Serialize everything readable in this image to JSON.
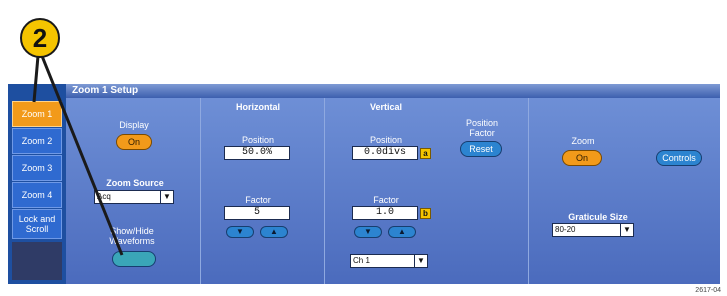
{
  "callout": {
    "number": "2"
  },
  "tabs": [
    {
      "label": "Zoom 1",
      "active": true
    },
    {
      "label": "Zoom 2",
      "active": false
    },
    {
      "label": "Zoom 3",
      "active": false
    },
    {
      "label": "Zoom 4",
      "active": false
    },
    {
      "label": "Lock and Scroll",
      "active": false
    }
  ],
  "panel": {
    "title": "Zoom 1 Setup",
    "display": {
      "label": "Display",
      "button": "On"
    },
    "zoom_source": {
      "label": "Zoom Source",
      "value": "Acq"
    },
    "show_hide": {
      "label": "Show/Hide Waveforms"
    },
    "horizontal": {
      "heading": "Horizontal",
      "position_label": "Position",
      "position_value": "50.0%",
      "factor_label": "Factor",
      "factor_value": "5"
    },
    "vertical": {
      "heading": "Vertical",
      "position_label": "Position",
      "position_value": "0.0divs",
      "position_badge": "a",
      "factor_label": "Factor",
      "factor_value": "1.0",
      "factor_badge": "b",
      "channel": "Ch 1"
    },
    "position_factor": {
      "label": "Position Factor",
      "button": "Reset"
    },
    "zoom": {
      "label": "Zoom",
      "button": "On"
    },
    "controls": {
      "button": "Controls"
    },
    "graticule": {
      "label": "Graticule Size",
      "value": "80-20"
    }
  },
  "figure_number": "2617-04"
}
